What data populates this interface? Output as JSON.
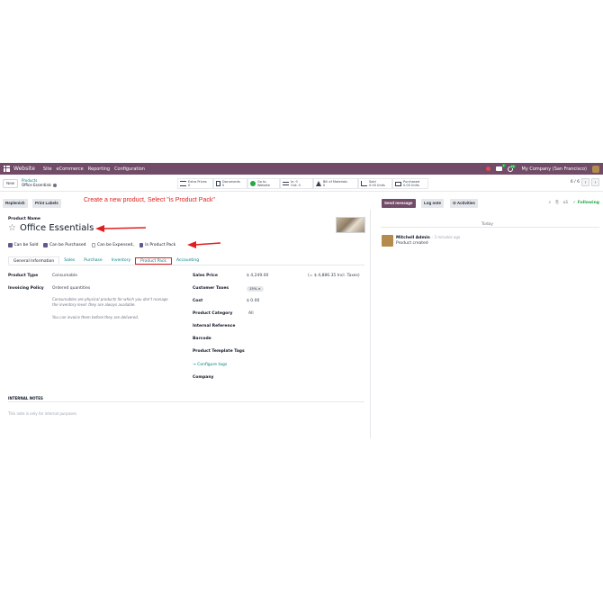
{
  "navbar": {
    "app_title": "Website",
    "menu": [
      "Site",
      "eCommerce",
      "Reporting",
      "Configuration"
    ],
    "chat_badge": "7",
    "clock_badge": "26",
    "company": "My Company (San Francisco)",
    "bg_color": "#714b67"
  },
  "control": {
    "new_label": "New",
    "breadcrumb_parent": "Products",
    "breadcrumb_current": "Office Essentials",
    "smart_buttons": [
      {
        "label": "Extra Prices",
        "value": "0"
      },
      {
        "label": "Documents",
        "value": "0"
      },
      {
        "label": "Go to",
        "value": "Website"
      },
      {
        "label": "In: 0",
        "value": "Out: 0"
      },
      {
        "label": "Bill of Materials",
        "value": "0"
      },
      {
        "label": "Sold",
        "value": "0.00 Units"
      },
      {
        "label": "Purchased",
        "value": "0.00 Units"
      }
    ],
    "pager": "6 / 6"
  },
  "actions": {
    "replenish": "Replenish",
    "print_labels": "Print Labels",
    "annotation": "Create a new product, Select \"is Product Pack\""
  },
  "form": {
    "name_label": "Product Name",
    "name": "Office Essentials",
    "checks": [
      {
        "label": "Can be Sold",
        "checked": true
      },
      {
        "label": "Can be Purchased",
        "checked": true
      },
      {
        "label": "Can be Expensed",
        "checked": false,
        "sup": "?"
      },
      {
        "label": "Is Product Pack",
        "checked": true
      }
    ],
    "tabs": [
      "General Information",
      "Sales",
      "Purchase",
      "Inventory",
      "Product Pack",
      "Accounting"
    ],
    "product_type_label": "Product Type",
    "product_type": "Consumable",
    "invoicing_policy_label": "Invoicing Policy",
    "invoicing_policy": "Ordered quantities",
    "help_1": "Consumables are physical products for which you don't manage",
    "help_2": "the inventory level: they are always available.",
    "help_3": "You can invoice them before they are delivered.",
    "sales_price_label": "Sales Price",
    "sales_price": "$ 4,249.00",
    "incl_taxes": "(= $ 4,886.35 Incl. Taxes)",
    "customer_taxes_label": "Customer Taxes",
    "customer_taxes_tag": "15% ×",
    "cost_label": "Cost",
    "cost": "$ 0.00",
    "product_category_label": "Product Category",
    "product_category": "All",
    "internal_reference_label": "Internal Reference",
    "barcode_label": "Barcode",
    "template_tags_label": "Product Template Tags",
    "configure_tags": "→ Configure tags",
    "company_label": "Company",
    "notes_label": "INTERNAL NOTES",
    "notes_placeholder": "This note is only for internal purposes."
  },
  "chatter": {
    "send_message": "Send message",
    "log_note": "Log note",
    "activities": "⊙ Activities",
    "followers": "1",
    "following": "✓ Following",
    "today": "Today",
    "author": "Mitchell Admin",
    "time": "- 2 minutes ago",
    "body": "Product created"
  }
}
